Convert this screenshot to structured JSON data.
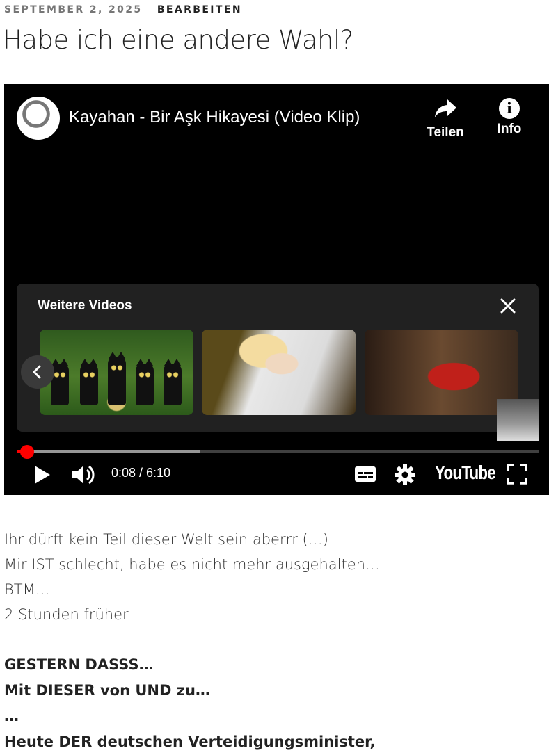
{
  "meta": {
    "date": "SEPTEMBER 2, 2025",
    "edit_label": "BEARBEITEN"
  },
  "post": {
    "title": "Habe ich eine andere Wahl?"
  },
  "video": {
    "title": "Kayahan - Bir Aşk Hikayesi (Video Klip)",
    "share_label": "Teilen",
    "info_label": "Info",
    "info_glyph": "i",
    "more_videos_label": "Weitere Videos",
    "time_display": "0:08 / 6:10",
    "brand_label": "YouTube",
    "progress_played_fraction": 0.0205,
    "progress_buffered_fraction": 0.35,
    "colors": {
      "accent": "#ff0000",
      "panel": "#212121",
      "background": "#000000"
    }
  },
  "content": {
    "lines": [
      "Ihr dürft kein Teil dieser Welt sein aberrr (…)",
      "Mir IST schlecht, habe es nicht mehr ausgehalten…",
      "BTM…",
      "2 Stunden früher"
    ],
    "bold_lines": [
      "GESTERN DASSS…",
      "Mit DIESER von UND zu…",
      "…",
      "Heute DER deutschen Verteidigungsminister,"
    ]
  },
  "icons": [
    "share-icon",
    "info-icon",
    "close-icon",
    "chevron-left-icon",
    "play-icon",
    "volume-icon",
    "subtitles-icon",
    "settings-icon",
    "fullscreen-icon"
  ]
}
